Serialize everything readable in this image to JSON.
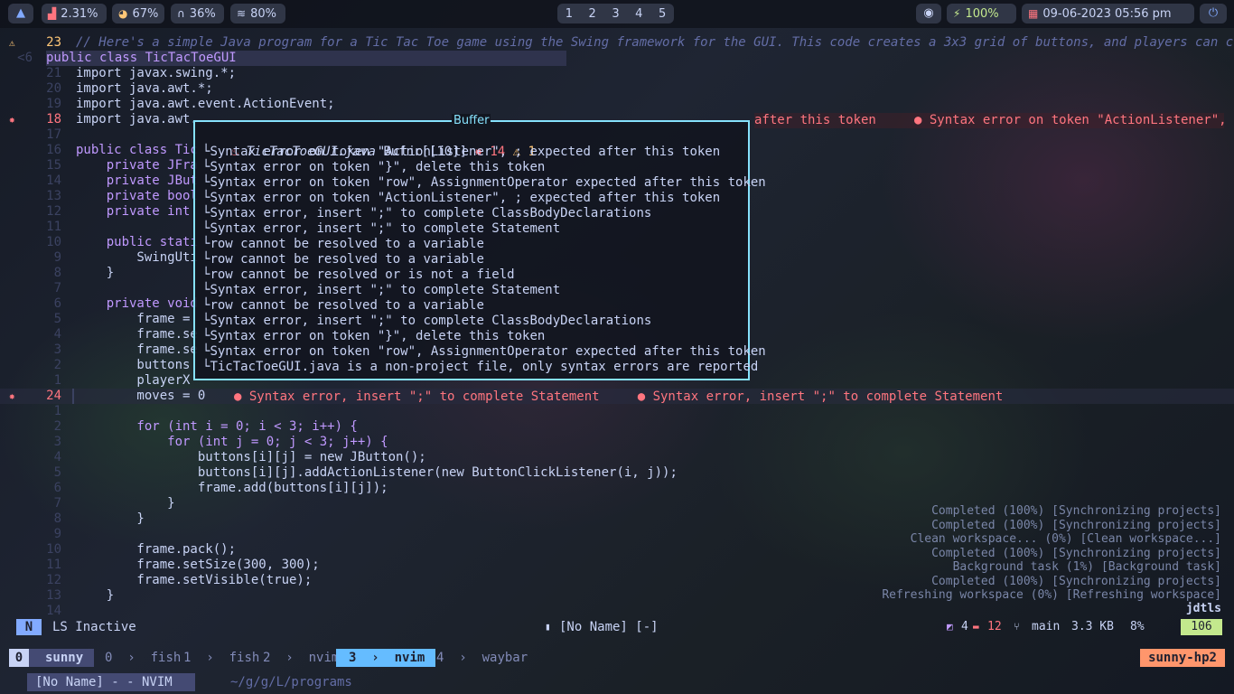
{
  "topbar": {
    "launcher_icon": "arch-icon",
    "cpu": "2.31%",
    "memory": "67%",
    "audio": "36%",
    "wifi": "80%",
    "workspaces": [
      "1",
      "2",
      "3",
      "4",
      "5"
    ],
    "battery": "100%",
    "datetime": "09-06-2023 05:56 pm"
  },
  "editor": {
    "lines": [
      {
        "num": "23",
        "sign": "⚠",
        "text": "// Here's a simple Java program for a Tic Tac Toe game using the Swing framework for the GUI. This code creates a 3x3 grid of buttons, and players can click on"
      },
      {
        "num": "<6",
        "sign": "",
        "text": "public class TicTacToeGUI"
      },
      {
        "num": "21",
        "sign": "",
        "text": "import javax.swing.*;"
      },
      {
        "num": "20",
        "sign": "",
        "text": "import java.awt.*;"
      },
      {
        "num": "19",
        "sign": "",
        "text": "import java.awt.event.ActionEvent;"
      },
      {
        "num": "18",
        "sign": "✸",
        "text": "import java.awt."
      },
      {
        "num": "17",
        "sign": "",
        "text": ""
      },
      {
        "num": "16",
        "sign": "",
        "text": "public class Tic"
      },
      {
        "num": "15",
        "sign": "",
        "text": "    private JFra"
      },
      {
        "num": "14",
        "sign": "",
        "text": "    private JBut"
      },
      {
        "num": "13",
        "sign": "",
        "text": "    private bool"
      },
      {
        "num": "12",
        "sign": "",
        "text": "    private int "
      },
      {
        "num": "11",
        "sign": "",
        "text": ""
      },
      {
        "num": "10",
        "sign": "",
        "text": "    public stati"
      },
      {
        "num": "9",
        "sign": "",
        "text": "        SwingUti"
      },
      {
        "num": "8",
        "sign": "",
        "text": "    }"
      },
      {
        "num": "7",
        "sign": "",
        "text": ""
      },
      {
        "num": "6",
        "sign": "",
        "text": "    private void"
      },
      {
        "num": "5",
        "sign": "",
        "text": "        frame = "
      },
      {
        "num": "4",
        "sign": "",
        "text": "        frame.se"
      },
      {
        "num": "3",
        "sign": "",
        "text": "        frame.se"
      },
      {
        "num": "2",
        "sign": "",
        "text": "        buttons "
      },
      {
        "num": "1",
        "sign": "",
        "text": "        playerX "
      },
      {
        "num": "24",
        "sign": "✸",
        "text": "        moves = 0"
      },
      {
        "num": "1",
        "sign": "",
        "text": ""
      },
      {
        "num": "2",
        "sign": "",
        "text": "        for (int i = 0; i < 3; i++) {"
      },
      {
        "num": "3",
        "sign": "",
        "text": "            for (int j = 0; j < 3; j++) {"
      },
      {
        "num": "4",
        "sign": "",
        "text": "                buttons[i][j] = new JButton();"
      },
      {
        "num": "5",
        "sign": "",
        "text": "                buttons[i][j].addActionListener(new ButtonClickListener(i, j));"
      },
      {
        "num": "6",
        "sign": "",
        "text": "                frame.add(buttons[i][j]);"
      },
      {
        "num": "7",
        "sign": "",
        "text": "            }"
      },
      {
        "num": "8",
        "sign": "",
        "text": "        }"
      },
      {
        "num": "9",
        "sign": "",
        "text": ""
      },
      {
        "num": "10",
        "sign": "",
        "text": "        frame.pack();"
      },
      {
        "num": "11",
        "sign": "",
        "text": "        frame.setSize(300, 300);"
      },
      {
        "num": "12",
        "sign": "",
        "text": "        frame.setVisible(true);"
      },
      {
        "num": "13",
        "sign": "",
        "text": "    }"
      },
      {
        "num": "14",
        "sign": "",
        "text": ""
      }
    ],
    "line18_virtual": "after this token     ● Syntax error on token \"ActionListener\", ;",
    "line24_virtual": "● Syntax error, insert \";\" to complete Statement     ● Syntax error, insert \";\" to complete Statement"
  },
  "popup": {
    "title": "Buffer",
    "filename": "TicTacToeGUI.java",
    "bufnr": "Bufnr[[10]]",
    "error_count": "14",
    "warn_count": "1",
    "items": [
      "Syntax error on token \"ActionListener\", ; expected after this token",
      "Syntax error on token \"}\", delete this token",
      "Syntax error on token \"row\", AssignmentOperator expected after this token",
      "Syntax error on token \"ActionListener\", ; expected after this token",
      "Syntax error, insert \";\" to complete ClassBodyDeclarations",
      "Syntax error, insert \";\" to complete Statement",
      "row cannot be resolved to a variable",
      "row cannot be resolved to a variable",
      "row cannot be resolved or is not a field",
      "Syntax error, insert \";\" to complete Statement",
      "row cannot be resolved to a variable",
      "Syntax error, insert \";\" to complete ClassBodyDeclarations",
      "Syntax error on token \"}\", delete this token",
      "Syntax error on token \"row\", AssignmentOperator expected after this token",
      "TicTacToeGUI.java is a non-project file, only syntax errors are reported"
    ]
  },
  "notifications": [
    "Completed (100%) [Synchronizing projects]",
    "Completed (100%) [Synchronizing projects]",
    "Clean workspace... (0%) [Clean workspace...]",
    "Completed (100%) [Synchronizing projects]",
    "Background task (1%) [Background task]",
    "Completed (100%) [Synchronizing projects]",
    "Refreshing workspace (0%) [Refreshing workspace]",
    "jdtls"
  ],
  "statusline": {
    "mode": "N",
    "lsp": "LS Inactive",
    "buffer": "[No Name] [-]",
    "added": "4",
    "removed": "12",
    "branch": "main",
    "size": "3.3 KB",
    "percent": "8%",
    "line": "106"
  },
  "tmux": {
    "session_index": "0",
    "session": "sunny",
    "windows": [
      {
        "idx": "0",
        "name": "fish",
        "active": false
      },
      {
        "idx": "1",
        "name": "fish",
        "active": false
      },
      {
        "idx": "2",
        "name": "nvim",
        "active": false
      },
      {
        "idx": "3",
        "name": "nvim",
        "active": true
      },
      {
        "idx": "4",
        "name": "waybar",
        "active": false
      }
    ],
    "host": "sunny-hp2"
  },
  "bottom": {
    "title": "[No Name] - - NVIM",
    "path": "~/g/g/L/programs"
  },
  "colors": {
    "accent": "#86e1fc",
    "error": "#ff757f",
    "warn": "#ffc777",
    "active_tab": "#65bcff"
  }
}
